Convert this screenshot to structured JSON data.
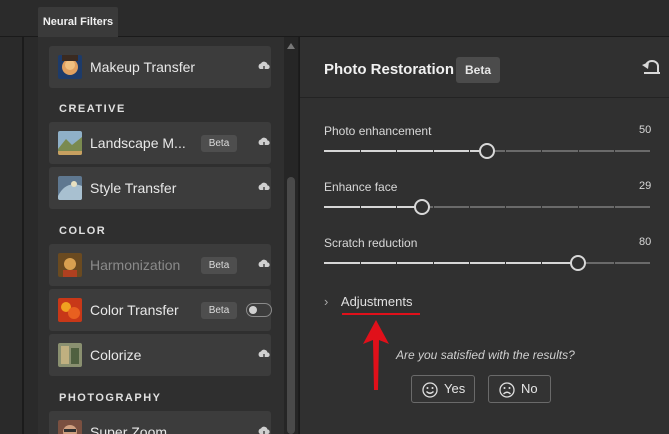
{
  "tab": {
    "label": "Neural Filters"
  },
  "sections": {
    "creative": "CREATIVE",
    "color": "COLOR",
    "photography": "PHOTOGRAPHY"
  },
  "filters": [
    {
      "name": "Makeup Transfer",
      "badge": "",
      "dim": false
    },
    {
      "name": "Landscape M...",
      "badge": "Beta",
      "dim": false
    },
    {
      "name": "Style Transfer",
      "badge": "",
      "dim": false
    },
    {
      "name": "Harmonization",
      "badge": "Beta",
      "dim": true
    },
    {
      "name": "Color Transfer",
      "badge": "Beta",
      "dim": false,
      "toggle": false
    },
    {
      "name": "Colorize",
      "badge": "",
      "dim": false
    },
    {
      "name": "Super Zoom",
      "badge": "",
      "dim": false
    }
  ],
  "panel": {
    "title": "Photo Restoration",
    "badge": "Beta",
    "sliders": [
      {
        "label": "Photo enhancement",
        "value": "50",
        "fraction": 0.5
      },
      {
        "label": "Enhance face",
        "value": "29",
        "fraction": 0.3
      },
      {
        "label": "Scratch reduction",
        "value": "80",
        "fraction": 0.78
      }
    ],
    "adjustments": "Adjustments",
    "question": "Are you satisfied with the results?",
    "yes": "Yes",
    "no": "No"
  },
  "colors": {
    "annotation": "#e0101a",
    "panel_bg": "#303030",
    "list_bg": "#2f2f2f"
  },
  "icons": [
    "download-cloud-icon",
    "reset-icon",
    "chevron-right-icon",
    "smile-icon",
    "frown-icon",
    "red-arrow-annotation"
  ]
}
